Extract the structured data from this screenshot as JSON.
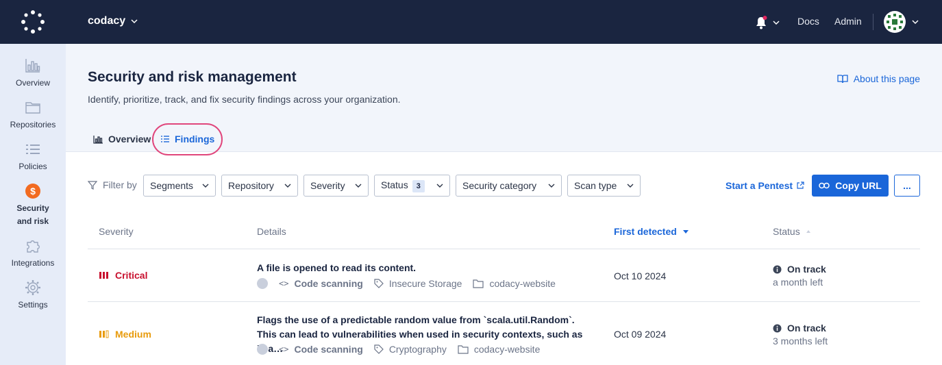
{
  "topbar": {
    "org_name": "codacy",
    "docs_label": "Docs",
    "admin_label": "Admin"
  },
  "sidebar": {
    "items": [
      {
        "label": "Overview",
        "icon": "bar-chart-icon"
      },
      {
        "label": "Repositories",
        "icon": "folder-icon"
      },
      {
        "label": "Policies",
        "icon": "list-icon"
      },
      {
        "label_line1": "Security",
        "label_line2": "and risk",
        "icon": "dollar-shield-icon"
      },
      {
        "label": "Integrations",
        "icon": "puzzle-icon"
      },
      {
        "label": "Settings",
        "icon": "gear-icon"
      }
    ]
  },
  "header": {
    "title": "Security and risk management",
    "subtitle": "Identify, prioritize, track, and fix security findings across your organization.",
    "about_label": "About this page",
    "tabs": [
      {
        "label": "Overview"
      },
      {
        "label": "Findings"
      }
    ]
  },
  "filters": {
    "filter_by_label": "Filter by",
    "selects": [
      {
        "label": "Segments"
      },
      {
        "label": "Repository"
      },
      {
        "label": "Severity"
      },
      {
        "label": "Status",
        "count": "3"
      },
      {
        "label": "Security category"
      },
      {
        "label": "Scan type"
      }
    ],
    "pentest_label": "Start a Pentest",
    "copy_url_label": "Copy URL",
    "more_label": "..."
  },
  "table": {
    "columns": {
      "severity": "Severity",
      "details": "Details",
      "first_detected": "First detected",
      "status": "Status"
    },
    "rows": [
      {
        "severity": "Critical",
        "title": "A file is opened to read its content.",
        "scan_type": "Code scanning",
        "category": "Insecure Storage",
        "repository": "codacy-website",
        "date": "Oct 10 2024",
        "status": "On track",
        "status_sub": "a month left"
      },
      {
        "severity": "Medium",
        "title": "Flags the use of a predictable random value from `scala.util.Random`. This can lead to vulnerabilities when used in security contexts, such as in a…",
        "scan_type": "Code scanning",
        "category": "Cryptography",
        "repository": "codacy-website",
        "date": "Oct 09 2024",
        "status": "On track",
        "status_sub": "3 months left"
      }
    ]
  },
  "colors": {
    "critical": "#c8102e",
    "medium": "#e89b0c",
    "accent": "#1a66d9",
    "security_icon": "#f26b21"
  }
}
